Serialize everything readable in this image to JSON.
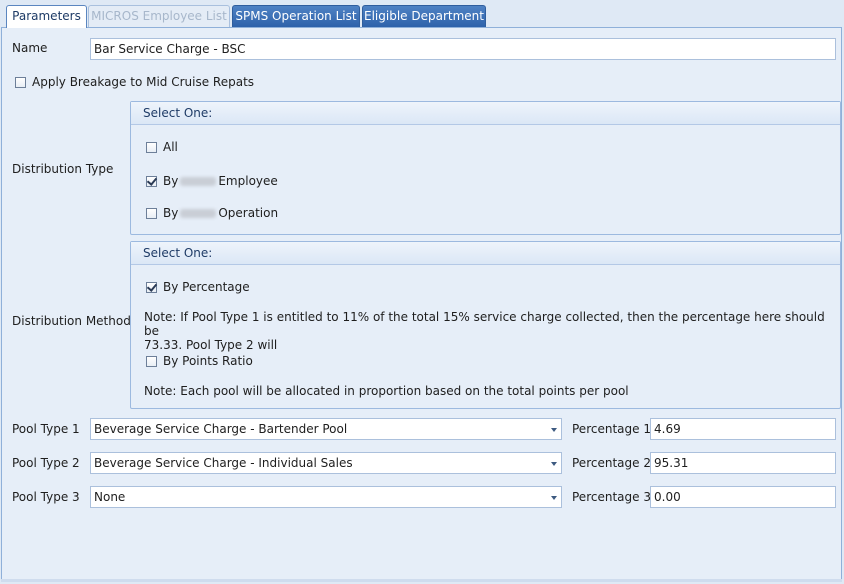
{
  "tabs": [
    {
      "label": "Parameters",
      "state": "active"
    },
    {
      "label": "MICROS Employee List",
      "state": "disabled"
    },
    {
      "label": "SPMS Operation List",
      "state": "normal"
    },
    {
      "label": "Eligible Department",
      "state": "normal"
    }
  ],
  "name": {
    "label": "Name",
    "value": "Bar Service Charge - BSC"
  },
  "breakage": {
    "label": "Apply Breakage to Mid Cruise Repats",
    "checked": false
  },
  "distribution_type": {
    "label": "Distribution Type",
    "group_title": "Select One:",
    "options": [
      {
        "prefix": "All",
        "suffix": "",
        "checked": false
      },
      {
        "prefix": "By",
        "suffix": "Employee",
        "checked": true
      },
      {
        "prefix": "By",
        "suffix": "Operation",
        "checked": false
      }
    ]
  },
  "distribution_method": {
    "label": "Distribution Method",
    "group_title": "Select One:",
    "percentage_option": {
      "label": "By Percentage",
      "checked": true
    },
    "percentage_note_line1": "Note: If Pool Type 1 is entitled to 11% of the total 15%  service charge collected, then the percentage here should be",
    "percentage_note_line2": "73.33. Pool Type 2 will",
    "points_option": {
      "label": "By Points Ratio",
      "checked": false
    },
    "points_note": "Note: Each pool will be allocated in proportion based on the total points per pool"
  },
  "pools": [
    {
      "label": "Pool Type 1",
      "value": "Beverage Service Charge - Bartender Pool",
      "pct_label": "Percentage 1",
      "pct_value": "4.69"
    },
    {
      "label": "Pool Type 2",
      "value": "Beverage Service Charge - Individual Sales",
      "pct_label": "Percentage 2",
      "pct_value": "95.31"
    },
    {
      "label": "Pool Type 3",
      "value": "None",
      "pct_label": "Percentage 3",
      "pct_value": "0.00"
    }
  ],
  "colors": {
    "accent_tab": "#2e62aa",
    "panel_bg": "#e6eef8",
    "border": "#8fb0d9"
  }
}
